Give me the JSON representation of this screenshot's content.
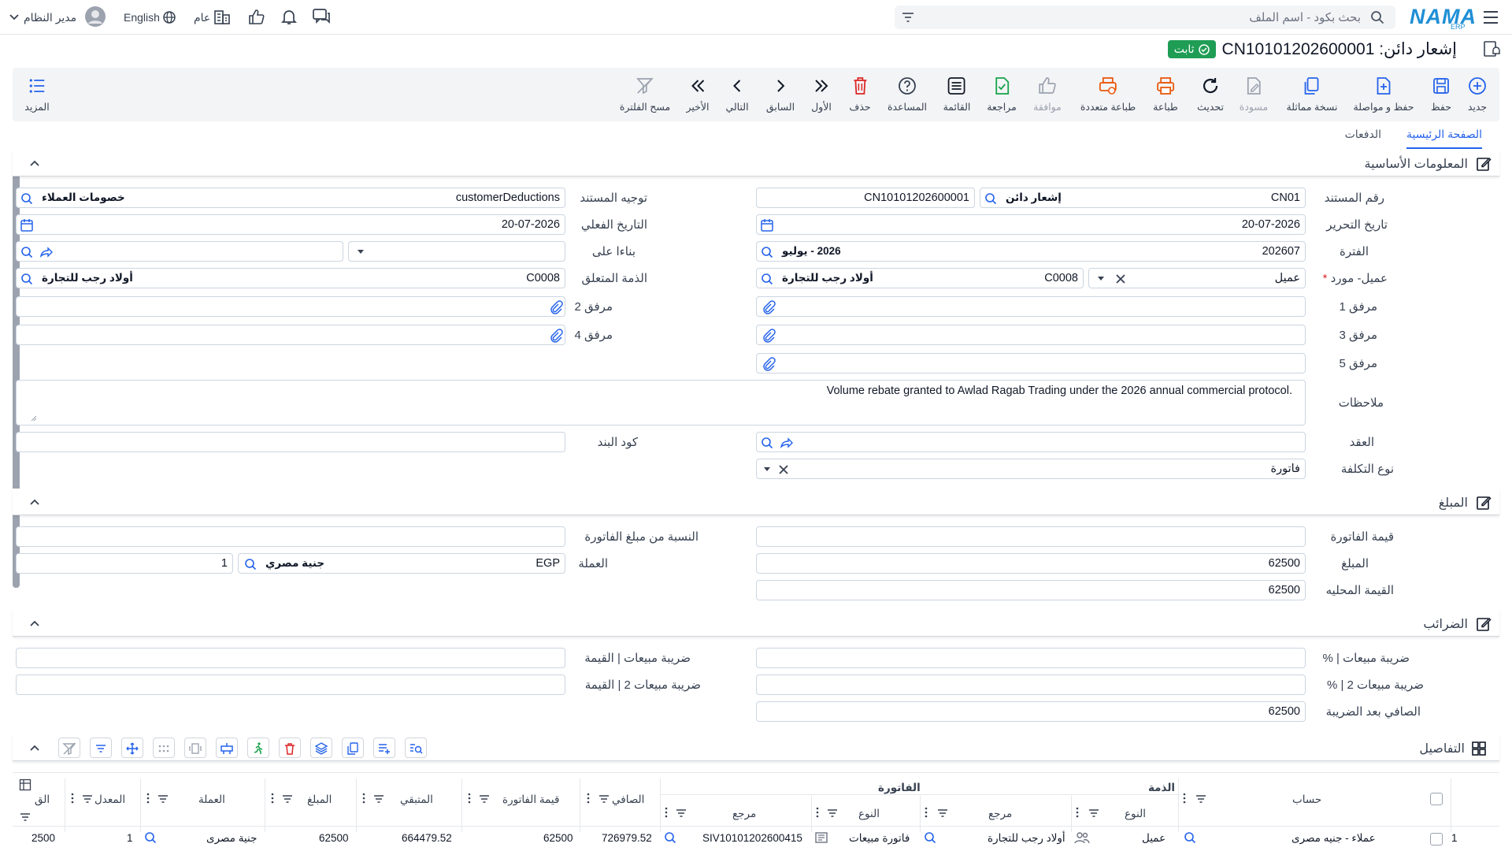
{
  "topbar": {
    "brand": "NAMA",
    "brand_sub": "ERP",
    "search_placeholder": "بحث بكود - اسم الملف",
    "language": "English",
    "scope": "عام",
    "user": "مدير النظام"
  },
  "page": {
    "title": "إشعار دائن: CN10101202600001",
    "status": "ثابت"
  },
  "toolbar": {
    "new": "جديد",
    "save": "حفظ",
    "save_continue": "حفظ و مواصلة",
    "duplicate": "نسخة مماثلة",
    "draft": "مسودة",
    "refresh": "تحديث",
    "print": "طباعة",
    "multi_print": "طباعة متعددة",
    "approve": "موافقة",
    "review": "مراجعة",
    "list": "القائمة",
    "help": "المساعدة",
    "delete": "حذف",
    "first": "الأول",
    "previous": "السابق",
    "next": "التالي",
    "last": "الأخير",
    "clear_filter": "مسح الفلترة",
    "more": "المزيد"
  },
  "tabs": {
    "main": "الصفحة الرئيسية",
    "payments": "الدفعات"
  },
  "sections": {
    "basic": "المعلومات الأساسية",
    "amount": "المبلغ",
    "taxes": "الضرائب",
    "details": "التفاصيل"
  },
  "basic": {
    "doc_no_label": "رقم المستند",
    "doc_no": "CN01",
    "doc_type": "إشعار دائن",
    "doc_full": "CN10101202600001",
    "direction_label": "توجيه المستند",
    "direction_value": "customerDeductions",
    "direction_tag": "خصومات العملاء",
    "edit_date_label": "تاريخ التحرير",
    "edit_date": "20-07-2026",
    "actual_date_label": "التاريخ الفعلي",
    "actual_date": "20-07-2026",
    "period_label": "الفترة",
    "period_value": "202607",
    "period_tag": "2026 - يوليو",
    "based_on_label": "بناءا على",
    "party_label": "عميل- مورد",
    "party_type": "عميل",
    "party_code": "C0008",
    "party_name": "أولاد رجب للتجارة",
    "related_label": "الذمة المتعلق",
    "related_code": "C0008",
    "related_name": "أولاد رجب للتجارة",
    "att1": "مرفق 1",
    "att2": "مرفق 2",
    "att3": "مرفق 3",
    "att4": "مرفق 4",
    "att5": "مرفق 5",
    "notes_label": "ملاحظات",
    "notes": "Volume rebate granted to Awlad Ragab Trading under the 2026 annual commercial protocol.",
    "contract_label": "العقد",
    "item_code_label": "كود البند",
    "cost_type_label": "نوع التكلفة",
    "cost_type": "فاتورة"
  },
  "amount": {
    "invoice_value_label": "قيمة الفاتورة",
    "pct_label": "النسبة من مبلغ الفاتورة",
    "amount_label": "المبلغ",
    "amount": "62500",
    "currency_label": "العملة",
    "currency_code": "EGP",
    "currency_name": "جنية مصري",
    "rate": "1",
    "local_label": "القيمة المحليه",
    "local": "62500"
  },
  "taxes": {
    "vat_pct": "ضريبة مبيعات | %",
    "vat_val": "ضريبة مبيعات | القيمة",
    "vat2_pct": "ضريبة مبيعات 2 | %",
    "vat2_val": "ضريبة مبيعات 2 | القيمة",
    "net_label": "الصافي بعد الضريبة",
    "net": "62500"
  },
  "grid": {
    "group_account": "الذمة",
    "group_invoice": "الفاتورة",
    "h_account": "حساب",
    "h_type": "النوع",
    "h_ref": "مرجع",
    "h_inv_type": "النوع",
    "h_inv_ref": "مرجع",
    "h_net": "الصافي",
    "h_inv_value": "قيمة الفاتورة",
    "h_remaining": "المتبقي",
    "h_amount": "المبلغ",
    "h_currency": "العملة",
    "h_rate": "المعدل",
    "h_cut": "الق",
    "row": {
      "no": "1",
      "account": "عملاء - جنيه مصرى",
      "type": "عميل",
      "ref": "أولاد رجب للتجارة",
      "inv_type": "فاتورة مبيعات",
      "inv_ref": "SIV10101202600415",
      "net": "726979.52",
      "inv_value": "62500",
      "remaining": "664479.52",
      "amount": "62500",
      "currency": "جنية مصرى",
      "rate": "1",
      "cut": "2500"
    }
  },
  "colors": {
    "accent": "#2563eb",
    "status": "#1f9d55",
    "delete": "#dc2626",
    "print": "#ea580c"
  }
}
